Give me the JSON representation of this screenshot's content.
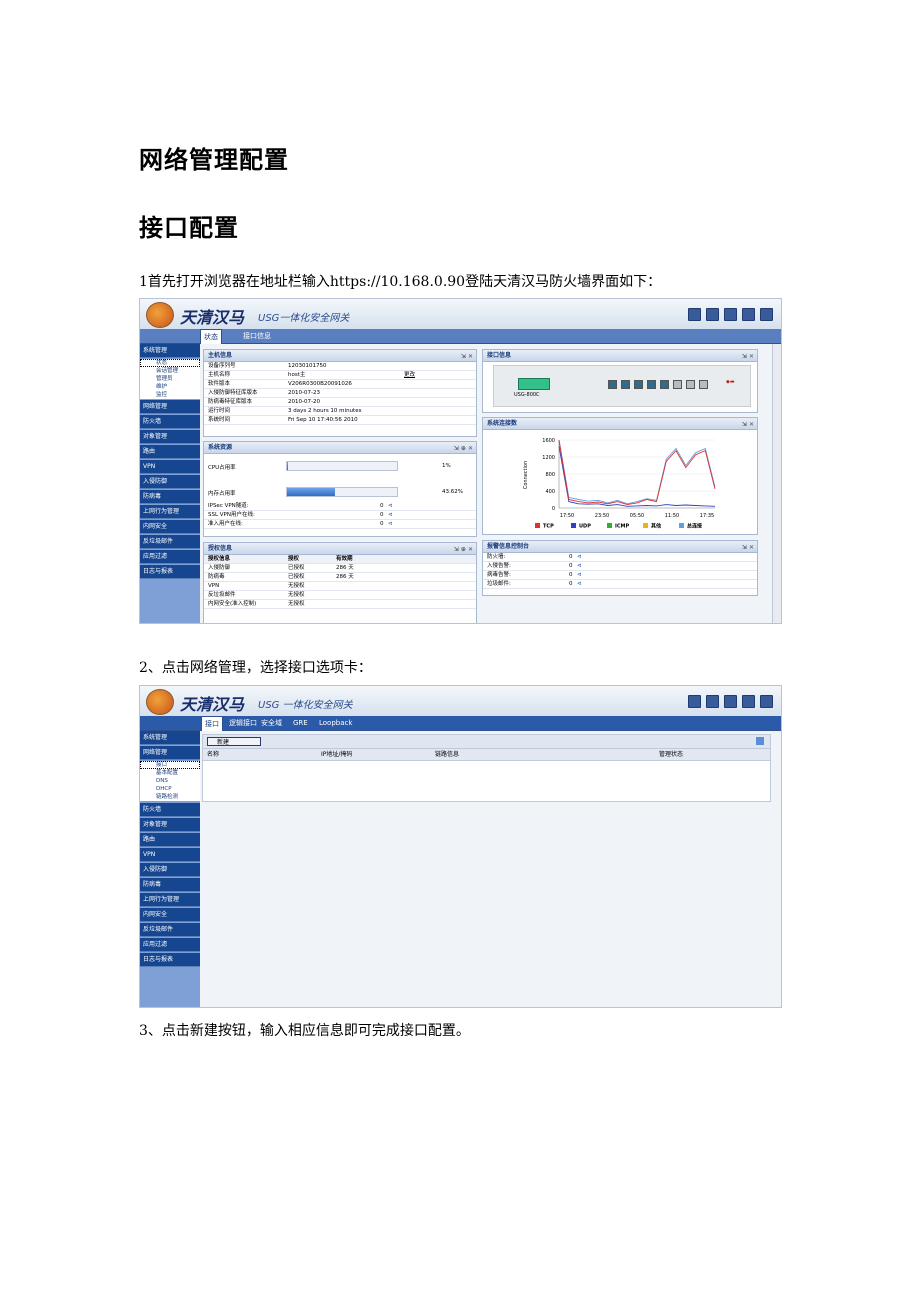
{
  "doc": {
    "title": "网络管理配置",
    "subtitle": "接口配置",
    "step1": "1首先打开浏览器在地址栏输入https://10.168.0.90登陆天清汉马防火墙界面如下：",
    "step2": "2、点击网络管理，选择接口选项卡：",
    "step3": "3、点击新建按钮，输入相应信息即可完成接口配置。"
  },
  "shot1": {
    "brand": "天清汉马",
    "brand_sub": "USG一体化安全网关",
    "tabs": [
      "状态",
      "接口信息"
    ],
    "sidebar": {
      "top": "系统管理",
      "subs": [
        "状态",
        "会话管理",
        "管理员",
        "维护",
        "监控"
      ],
      "items": [
        "网络管理",
        "防火墙",
        "对象管理",
        "路由",
        "VPN",
        "入侵防御",
        "防病毒",
        "上网行为管理",
        "内网安全",
        "反垃圾邮件",
        "应用过滤",
        "日志与报表"
      ]
    },
    "host_panel": {
      "title": "主机信息",
      "rows": [
        [
          "设备序列号",
          "12030101750",
          ""
        ],
        [
          "主机名称",
          "host主",
          "更改"
        ],
        [
          "软件版本",
          "V206R0300B20091026",
          ""
        ],
        [
          "入侵防御特征库版本",
          "2010-07-23",
          ""
        ],
        [
          "防病毒特征库版本",
          "2010-07-20",
          ""
        ],
        [
          "运行时间",
          "3 days 2 hours 10 minutes",
          ""
        ],
        [
          "系统时间",
          "Fri Sep 10 17:40:56 2010",
          ""
        ]
      ]
    },
    "resource_panel": {
      "title": "系统资源",
      "cpu_label": "CPU占用率",
      "cpu_value": "1%",
      "cpu_fraction": 0.01,
      "mem_label": "内存占用率",
      "mem_value": "43.62%",
      "mem_fraction": 0.4362,
      "rows": [
        [
          "IPSec VPN隧道:",
          "0"
        ],
        [
          "SSL VPN用户在线:",
          "0"
        ],
        [
          "准入用户在线:",
          "0"
        ]
      ]
    },
    "license_panel": {
      "title": "授权信息",
      "headers": [
        "授权信息",
        "授权",
        "有效期"
      ],
      "rows": [
        [
          "入侵防御",
          "已授权",
          "286 天"
        ],
        [
          "防病毒",
          "已授权",
          "286 天"
        ],
        [
          "VPN",
          "无授权",
          ""
        ],
        [
          "反垃圾邮件",
          "无授权",
          ""
        ],
        [
          "内网安全(准入控制)",
          "无授权",
          ""
        ]
      ]
    },
    "iface_panel": {
      "title": "接口信息",
      "device": "USG-800C"
    },
    "conn_panel": {
      "title": "系统连接数",
      "ylabel": "Connection"
    },
    "alarm_panel": {
      "title": "报警信息控制台",
      "rows": [
        [
          "防火墙:",
          "0"
        ],
        [
          "入侵告警:",
          "0"
        ],
        [
          "病毒告警:",
          "0"
        ],
        [
          "垃圾邮件:",
          "0"
        ]
      ]
    }
  },
  "chart_data": {
    "type": "line",
    "ylabel": "Connection",
    "ylim": [
      0,
      1600
    ],
    "yticks": [
      0,
      400,
      800,
      1200,
      1600
    ],
    "xticks": [
      "17:50",
      "23:50",
      "05:50",
      "11:50",
      "17:35"
    ],
    "series": [
      {
        "name": "TCP",
        "color": "#e03030",
        "values": [
          1600,
          200,
          150,
          120,
          140,
          100,
          150,
          80,
          120,
          200,
          150,
          1100,
          1350,
          950,
          1250,
          1350,
          450
        ]
      },
      {
        "name": "UDP",
        "color": "#3040c0",
        "values": [
          1450,
          150,
          100,
          90,
          100,
          60,
          80,
          40,
          50,
          60,
          50,
          80,
          60,
          70,
          60,
          50,
          40
        ]
      },
      {
        "name": "ICMP",
        "color": "#30b030",
        "values": [
          0,
          0,
          0,
          0,
          0,
          0,
          0,
          0,
          0,
          0,
          0,
          0,
          0,
          0,
          0,
          0,
          0
        ]
      },
      {
        "name": "其他",
        "color": "#f0b020",
        "values": [
          0,
          0,
          0,
          0,
          0,
          0,
          0,
          0,
          0,
          0,
          0,
          0,
          0,
          0,
          0,
          0,
          0
        ]
      },
      {
        "name": "总连接",
        "color": "#60a0e0",
        "values": [
          1600,
          250,
          200,
          160,
          180,
          120,
          180,
          100,
          150,
          220,
          180,
          1150,
          1400,
          1000,
          1300,
          1400,
          500
        ]
      }
    ]
  },
  "shot2": {
    "brand": "天清汉马",
    "brand_sub": "USG 一体化安全网关",
    "tabs": [
      "接口",
      "逻辑接口",
      "安全域",
      "GRE",
      "Loopback"
    ],
    "sidebar": {
      "top": [
        "系统管理",
        "网络管理"
      ],
      "subs": [
        "接口",
        "基本配置",
        "DNS",
        "DHCP",
        "链路检测"
      ],
      "items": [
        "防火墙",
        "对象管理",
        "路由",
        "VPN",
        "入侵防御",
        "防病毒",
        "上网行为管理",
        "内网安全",
        "反垃圾邮件",
        "应用过滤",
        "日志与报表"
      ]
    },
    "new_button": "新建",
    "headers": [
      "名称",
      "IP地址/掩码",
      "链路信息",
      "管理状态"
    ]
  }
}
